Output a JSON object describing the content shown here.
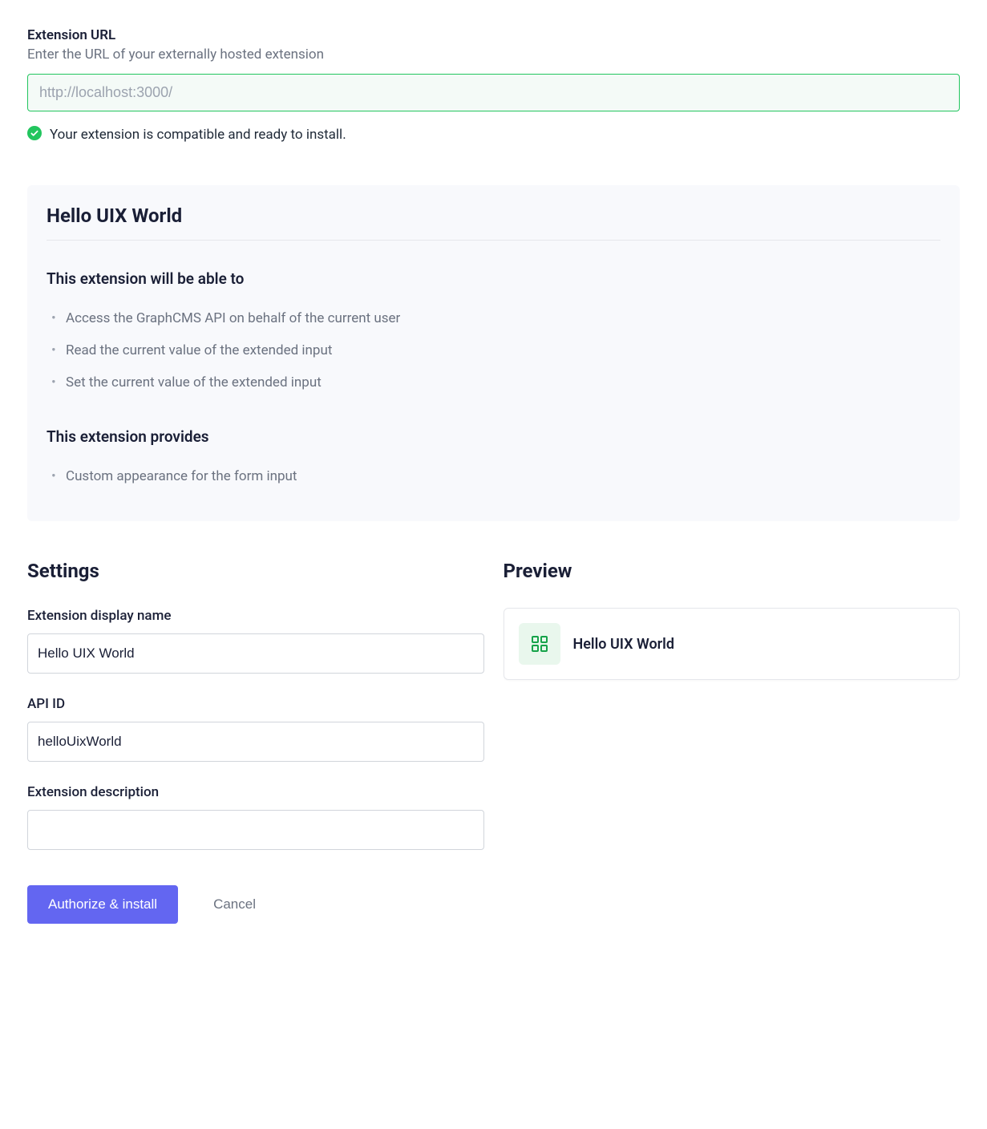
{
  "url_section": {
    "label": "Extension URL",
    "sublabel": "Enter the URL of your externally hosted extension",
    "value": "http://localhost:3000/",
    "status_text": "Your extension is compatible and ready to install."
  },
  "panel": {
    "title": "Hello UIX World",
    "able_to_heading": "This extension will be able to",
    "permissions": [
      "Access the GraphCMS API on behalf of the current user",
      "Read the current value of the extended input",
      "Set the current value of the extended input"
    ],
    "provides_heading": "This extension provides",
    "provides": [
      "Custom appearance for the form input"
    ]
  },
  "settings": {
    "heading": "Settings",
    "display_name_label": "Extension display name",
    "display_name_value": "Hello UIX World",
    "api_id_label": "API ID",
    "api_id_value": "helloUixWorld",
    "description_label": "Extension description",
    "description_value": ""
  },
  "preview": {
    "heading": "Preview",
    "name": "Hello UIX World"
  },
  "buttons": {
    "primary": "Authorize & install",
    "cancel": "Cancel"
  }
}
